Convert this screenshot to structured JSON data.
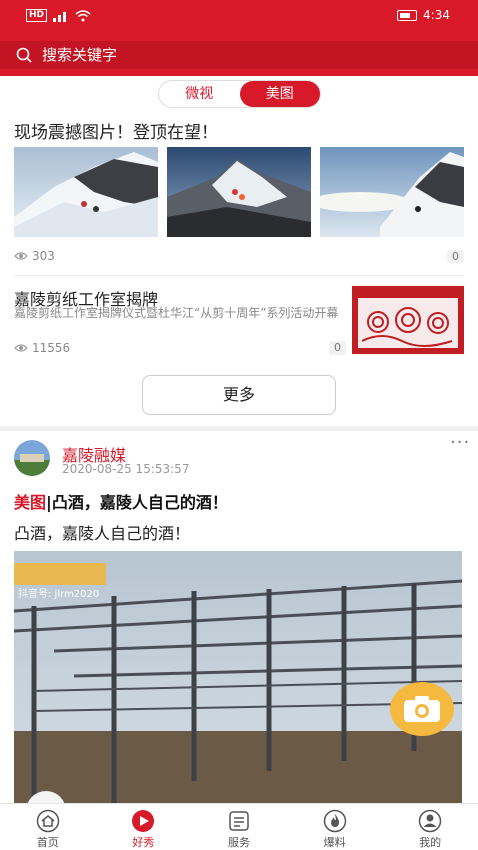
{
  "status_bar": {
    "signal": "HD",
    "time": "4:34"
  },
  "search": {
    "placeholder": "搜索关键字"
  },
  "tabs": [
    {
      "label": "微视",
      "active": false
    },
    {
      "label": "美图",
      "active": true
    }
  ],
  "photo_card": {
    "title": "现场震撼图片！登顶在望！",
    "views": "303",
    "comments": "0"
  },
  "news_item": {
    "title": "嘉陵剪纸工作室揭牌",
    "description": "嘉陵剪纸工作室揭牌仪式暨杜华江“从剪十周年”系列活动开幕",
    "views": "11556",
    "comments": "0"
  },
  "more_button": {
    "label": "更多"
  },
  "post": {
    "author": "嘉陵融媒",
    "time": "2020-08-25 15:53:57",
    "tag": "美图",
    "separator": "|",
    "headline": "凸酒，嘉陵人自己的酒！",
    "text": "凸酒，嘉陵人自己的酒！",
    "watermark": "抖音号: jlrm2020"
  },
  "bottom_nav": [
    {
      "label": "首页",
      "icon": "home-icon",
      "active": false
    },
    {
      "label": "好秀",
      "icon": "play-icon",
      "active": true
    },
    {
      "label": "服务",
      "icon": "service-icon",
      "active": false
    },
    {
      "label": "爆料",
      "icon": "fire-icon",
      "active": false
    },
    {
      "label": "我的",
      "icon": "user-icon",
      "active": false
    }
  ],
  "colors": {
    "brand": "#d8192a",
    "camera_button": "#f4b93e"
  }
}
